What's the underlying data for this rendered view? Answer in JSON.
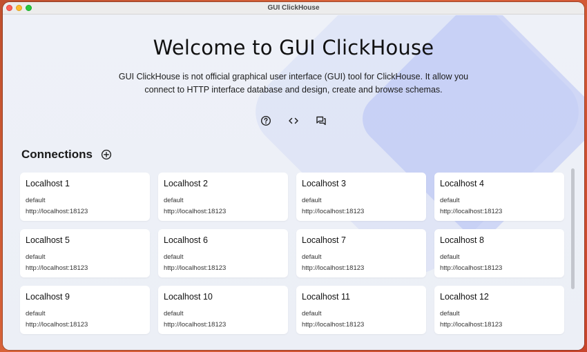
{
  "window": {
    "title": "GUI ClickHouse"
  },
  "hero": {
    "heading": "Welcome to GUI ClickHouse",
    "description": "GUI ClickHouse is not official graphical user interface (GUI) tool for ClickHouse. It allow you connect to HTTP interface database and design, create and browse schemas."
  },
  "toolbar_icons": [
    "help-icon",
    "code-icon",
    "chat-icon"
  ],
  "connections": {
    "title": "Connections",
    "items": [
      {
        "name": "Localhost 1",
        "database": "default",
        "url": "http://localhost:18123"
      },
      {
        "name": "Localhost 2",
        "database": "default",
        "url": "http://localhost:18123"
      },
      {
        "name": "Localhost 3",
        "database": "default",
        "url": "http://localhost:18123"
      },
      {
        "name": "Localhost 4",
        "database": "default",
        "url": "http://localhost:18123"
      },
      {
        "name": "Localhost 5",
        "database": "default",
        "url": "http://localhost:18123"
      },
      {
        "name": "Localhost 6",
        "database": "default",
        "url": "http://localhost:18123"
      },
      {
        "name": "Localhost 7",
        "database": "default",
        "url": "http://localhost:18123"
      },
      {
        "name": "Localhost 8",
        "database": "default",
        "url": "http://localhost:18123"
      },
      {
        "name": "Localhost 9",
        "database": "default",
        "url": "http://localhost:18123"
      },
      {
        "name": "Localhost 10",
        "database": "default",
        "url": "http://localhost:18123"
      },
      {
        "name": "Localhost 11",
        "database": "default",
        "url": "http://localhost:18123"
      },
      {
        "name": "Localhost 12",
        "database": "default",
        "url": "http://localhost:18123"
      }
    ]
  }
}
